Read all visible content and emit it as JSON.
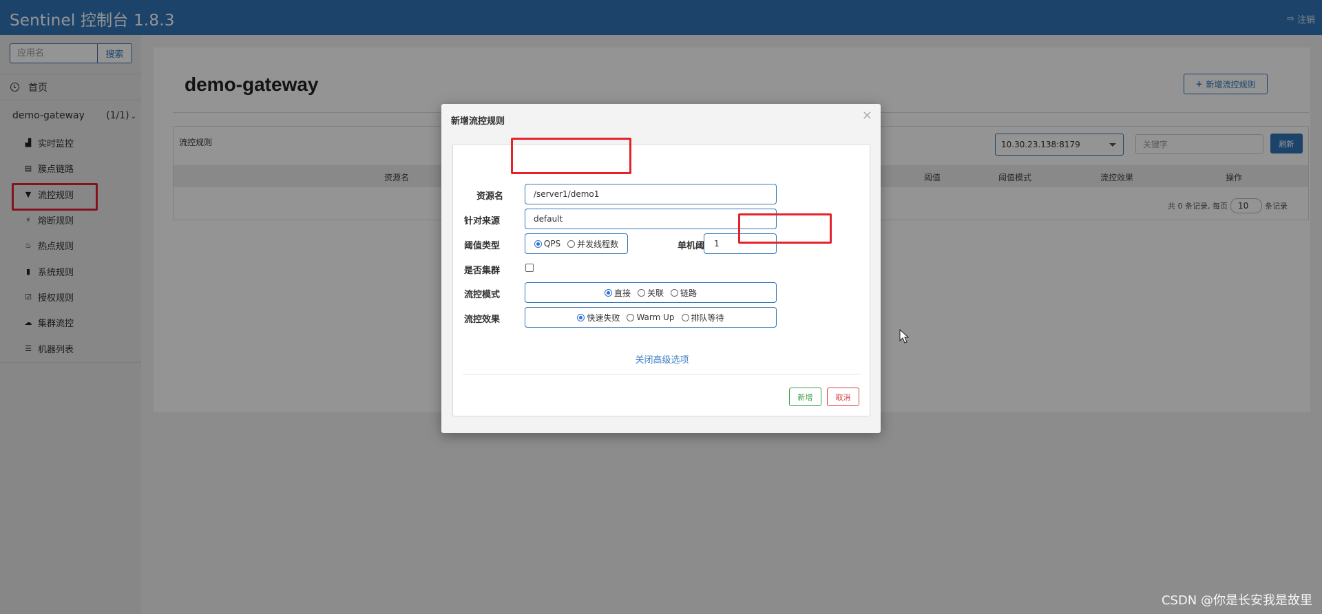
{
  "header": {
    "title": "Sentinel 控制台 1.8.3",
    "logout_label": "注销"
  },
  "sidebar": {
    "search_placeholder": "应用名",
    "search_button": "搜索",
    "home_label": "首页",
    "app_name": "demo-gateway",
    "app_count": "(1/1)",
    "menu": [
      {
        "label": "实时监控",
        "icon": "chart-icon",
        "glyph": "▟"
      },
      {
        "label": "簇点链路",
        "icon": "list-icon",
        "glyph": "▤"
      },
      {
        "label": "流控规则",
        "icon": "filter-icon",
        "glyph": "▼",
        "active": true
      },
      {
        "label": "熔断规则",
        "icon": "bolt-icon",
        "glyph": "⚡"
      },
      {
        "label": "热点规则",
        "icon": "fire-icon",
        "glyph": "♨"
      },
      {
        "label": "系统规则",
        "icon": "lock-icon",
        "glyph": "▮"
      },
      {
        "label": "授权规则",
        "icon": "check-icon",
        "glyph": "☑"
      },
      {
        "label": "集群流控",
        "icon": "cloud-icon",
        "glyph": "☁"
      },
      {
        "label": "机器列表",
        "icon": "th-list-icon",
        "glyph": "☰"
      }
    ]
  },
  "main": {
    "page_title": "demo-gateway",
    "add_rule_button": "新增流控规则",
    "table_title": "流控规则",
    "machine_select": "10.30.23.138:8179",
    "keyword_placeholder": "关键字",
    "refresh_button": "刷新",
    "columns": [
      "资源名",
      "阈值",
      "阈值模式",
      "流控效果",
      "操作"
    ],
    "pager": {
      "prefix": "共 0 条记录, 每页",
      "page_size": "10",
      "suffix": "条记录"
    }
  },
  "modal": {
    "title": "新增流控规则",
    "close_glyph": "×",
    "resource_label": "资源名",
    "resource_value": "/server1/demo1",
    "origin_label": "针对来源",
    "origin_value": "default",
    "threshold_type_label": "阈值类型",
    "threshold_type_options": [
      "QPS",
      "并发线程数"
    ],
    "single_threshold_label": "单机阈值",
    "single_threshold_value": "1",
    "cluster_label": "是否集群",
    "mode_label": "流控模式",
    "mode_options": [
      "直接",
      "关联",
      "链路"
    ],
    "effect_label": "流控效果",
    "effect_options": [
      "快速失败",
      "Warm Up",
      "排队等待"
    ],
    "advanced_link": "关闭高级选项",
    "add_button": "新增",
    "cancel_button": "取消"
  },
  "watermark": "CSDN @你是长安我是故里",
  "colors": {
    "header": "#3175b7",
    "highlight": "#e3222b",
    "add": "#3a9b48",
    "cancel": "#d9434a"
  }
}
